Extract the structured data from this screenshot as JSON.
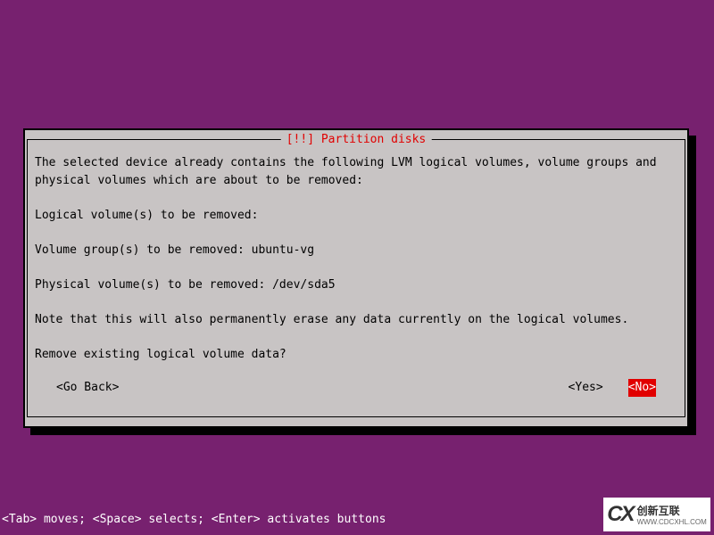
{
  "dialog": {
    "title": "[!!] Partition disks",
    "body_lines": {
      "l1": "The selected device already contains the following LVM logical volumes, volume groups and",
      "l2": "physical volumes which are about to be removed:",
      "l3": "",
      "l4": "Logical volume(s) to be removed:",
      "l5": "",
      "l6": "Volume group(s) to be removed: ubuntu-vg",
      "l7": "",
      "l8": "Physical volume(s) to be removed: /dev/sda5",
      "l9": "",
      "l10": "Note that this will also permanently erase any data currently on the logical volumes.",
      "l11": "",
      "l12": "Remove existing logical volume data?"
    },
    "buttons": {
      "back": "<Go Back>",
      "yes": "<Yes>",
      "no": "<No>"
    }
  },
  "help_bar": "<Tab> moves; <Space> selects; <Enter> activates buttons",
  "watermark": {
    "logo": "CX",
    "text": "创新互联",
    "sub": "WWW.CDCXHL.COM"
  }
}
